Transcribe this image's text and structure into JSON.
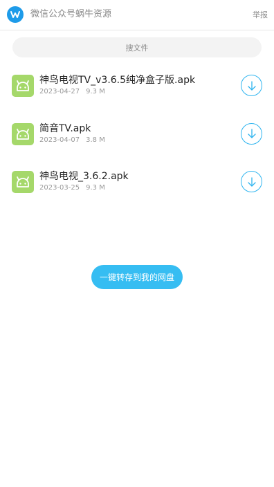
{
  "header": {
    "title": "微信公众号蜗牛资源",
    "report_label": "举报",
    "logo_icon": "w-logo-icon",
    "logo_color": "#1e9be9"
  },
  "search": {
    "placeholder": "搜文件"
  },
  "files": [
    {
      "name": "神鸟电视TV_v3.6.5纯净盒子版.apk",
      "date": "2023-04-27",
      "size": "9.3 M",
      "icon": "android-icon"
    },
    {
      "name": "简音TV.apk",
      "date": "2023-04-07",
      "size": "3.8 M",
      "icon": "android-icon"
    },
    {
      "name": "神鸟电视_3.6.2.apk",
      "date": "2023-03-25",
      "size": "9.3 M",
      "icon": "android-icon"
    }
  ],
  "actions": {
    "save_all_label": "一键转存到我的网盘"
  },
  "colors": {
    "accent": "#36bdf2",
    "file_icon_bg": "#a5d86a"
  }
}
